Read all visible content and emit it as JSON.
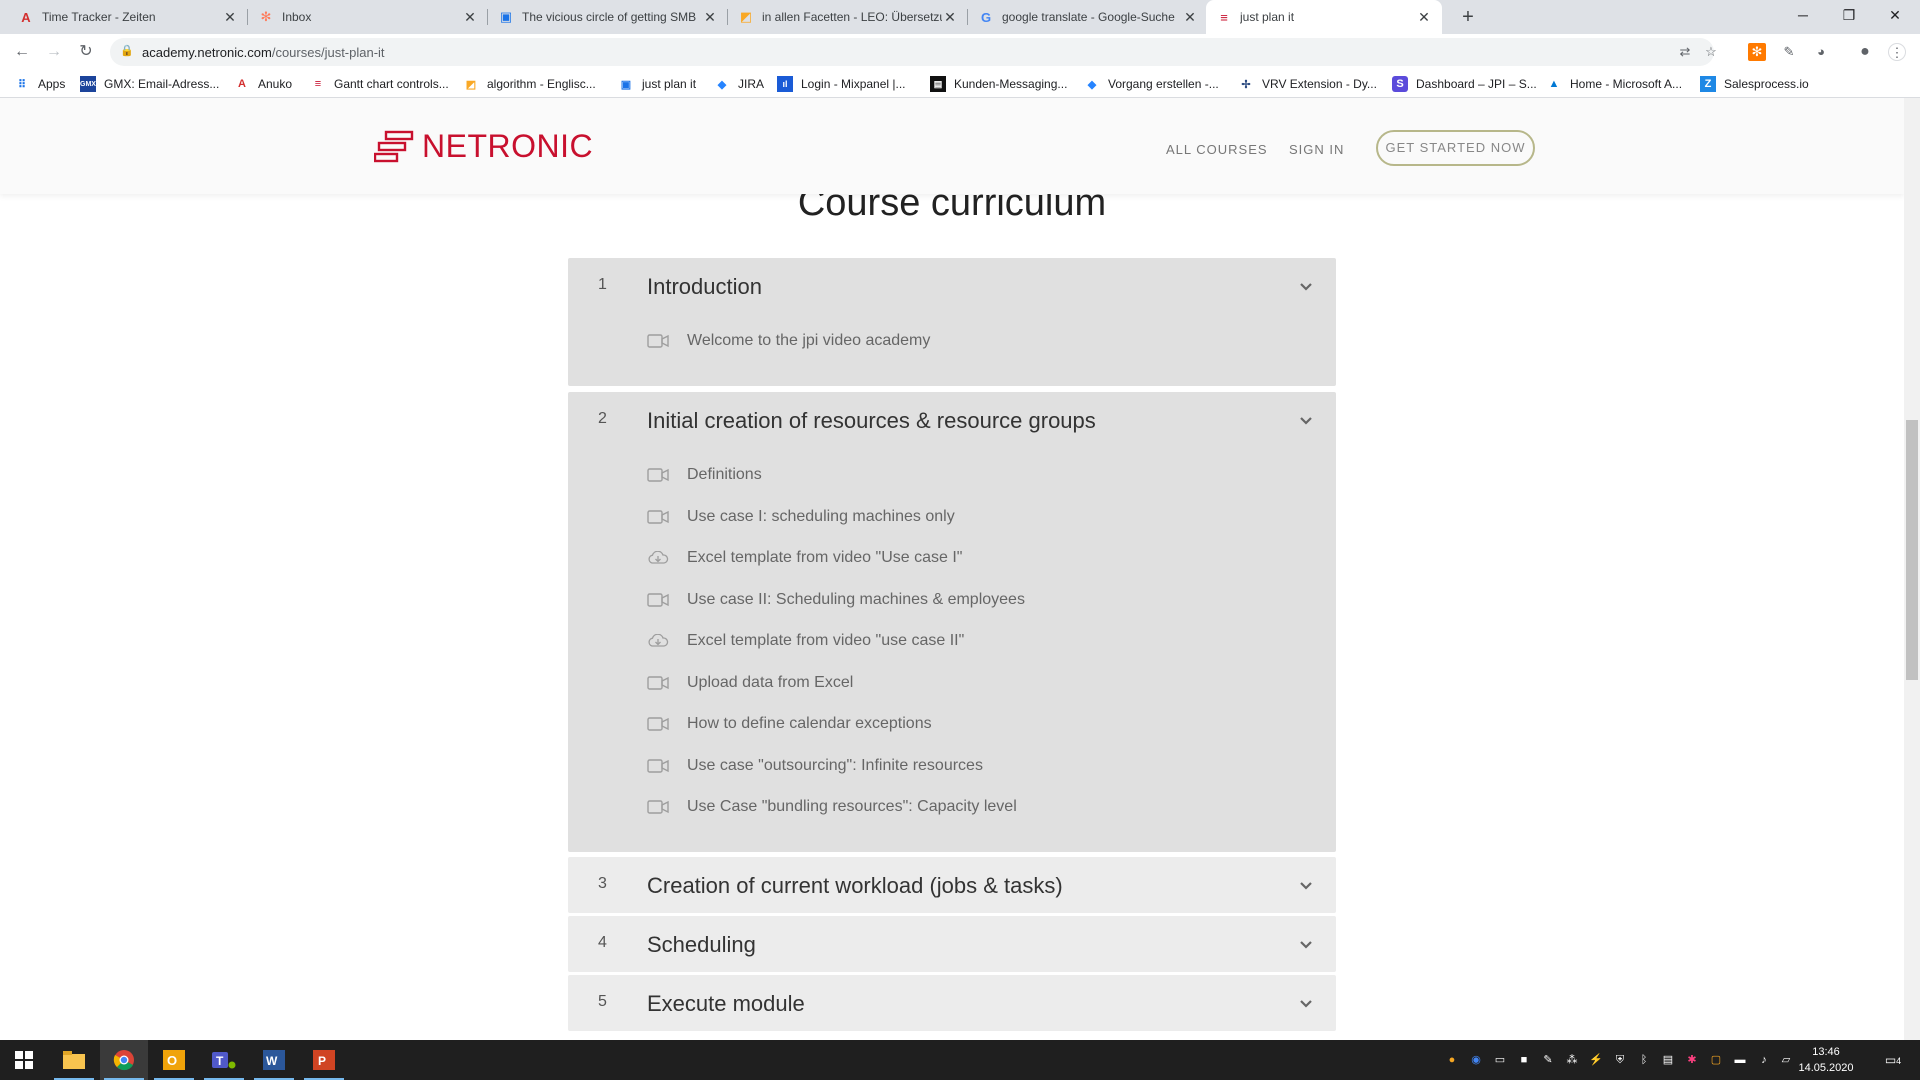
{
  "browser": {
    "tabs": [
      {
        "label": "Time Tracker - Zeiten",
        "icon": "acrobat-icon",
        "color": "#d32f2f"
      },
      {
        "label": "Inbox",
        "icon": "hubspot-icon",
        "color": "#ff7a59"
      },
      {
        "label": "The vicious circle of getting SMB",
        "icon": "bookmark-page-icon",
        "color": "#1a73e8"
      },
      {
        "label": "in allen Facetten - LEO: Übersetzu",
        "icon": "leo-icon",
        "color": "#f9a825"
      },
      {
        "label": "google translate - Google-Suche",
        "icon": "google-icon",
        "color": "#4285f4"
      },
      {
        "label": "just plan it",
        "icon": "netronic-favicon-icon",
        "color": "#c8102e"
      }
    ],
    "url_host": "academy.netronic.com",
    "url_path": "/courses/just-plan-it",
    "bookmarks": [
      {
        "label": "Apps",
        "icon": "apps-grid-icon"
      },
      {
        "label": "GMX: Email-Adress...",
        "icon": "gmx-icon"
      },
      {
        "label": "Anuko",
        "icon": "acrobat-icon"
      },
      {
        "label": "Gantt chart controls...",
        "icon": "netronic-favicon-icon"
      },
      {
        "label": "algorithm - Englisc...",
        "icon": "leo-icon"
      },
      {
        "label": "just plan it",
        "icon": "bookmark-page-icon"
      },
      {
        "label": "JIRA",
        "icon": "jira-icon"
      },
      {
        "label": "Login - Mixpanel |...",
        "icon": "mixpanel-icon"
      },
      {
        "label": "Kunden-Messaging...",
        "icon": "intercom-icon"
      },
      {
        "label": "Vorgang erstellen -...",
        "icon": "jira-icon"
      },
      {
        "label": "VRV Extension - Dy...",
        "icon": "dynamics-icon"
      },
      {
        "label": "Dashboard – JPI – S...",
        "icon": "s-icon"
      },
      {
        "label": "Home - Microsoft A...",
        "icon": "azure-icon"
      },
      {
        "label": "Salesprocess.io",
        "icon": "salesprocess-icon"
      }
    ]
  },
  "site": {
    "logo_text": "NETRONIC",
    "nav": {
      "all_courses": "ALL COURSES",
      "sign_in": "SIGN IN",
      "cta": "GET STARTED NOW"
    },
    "curriculum_title": "Course curriculum",
    "sections": [
      {
        "num": "1",
        "title": "Introduction",
        "expanded": true,
        "lessons": [
          {
            "label": "Welcome to the jpi video academy",
            "icon": "video-icon"
          }
        ]
      },
      {
        "num": "2",
        "title": "Initial creation of resources & resource groups",
        "expanded": true,
        "lessons": [
          {
            "label": "Definitions",
            "icon": "video-icon"
          },
          {
            "label": "Use case I: scheduling machines only",
            "icon": "video-icon"
          },
          {
            "label": "Excel template from video \"Use case I\"",
            "icon": "download-cloud-icon"
          },
          {
            "label": "Use case II: Scheduling machines & employees",
            "icon": "video-icon"
          },
          {
            "label": "Excel template from video \"use case II\"",
            "icon": "download-cloud-icon"
          },
          {
            "label": "Upload data from Excel",
            "icon": "video-icon"
          },
          {
            "label": "How to define calendar exceptions",
            "icon": "video-icon"
          },
          {
            "label": "Use case \"outsourcing\": Infinite resources",
            "icon": "video-icon"
          },
          {
            "label": "Use Case \"bundling resources\": Capacity level",
            "icon": "video-icon"
          }
        ]
      },
      {
        "num": "3",
        "title": "Creation of current workload (jobs & tasks)",
        "expanded": false,
        "lessons": []
      },
      {
        "num": "4",
        "title": "Scheduling",
        "expanded": false,
        "lessons": []
      },
      {
        "num": "5",
        "title": "Execute module",
        "expanded": false,
        "lessons": []
      }
    ]
  },
  "taskbar": {
    "time": "13:46",
    "date": "14.05.2020",
    "notification_count": "4",
    "apps": [
      "windows-start-icon",
      "file-explorer-icon",
      "chrome-icon",
      "outlook-icon",
      "teams-icon",
      "word-icon",
      "powerpoint-icon"
    ]
  },
  "colors": {
    "brand": "#c8102e",
    "cta_border": "#b7b78a"
  }
}
